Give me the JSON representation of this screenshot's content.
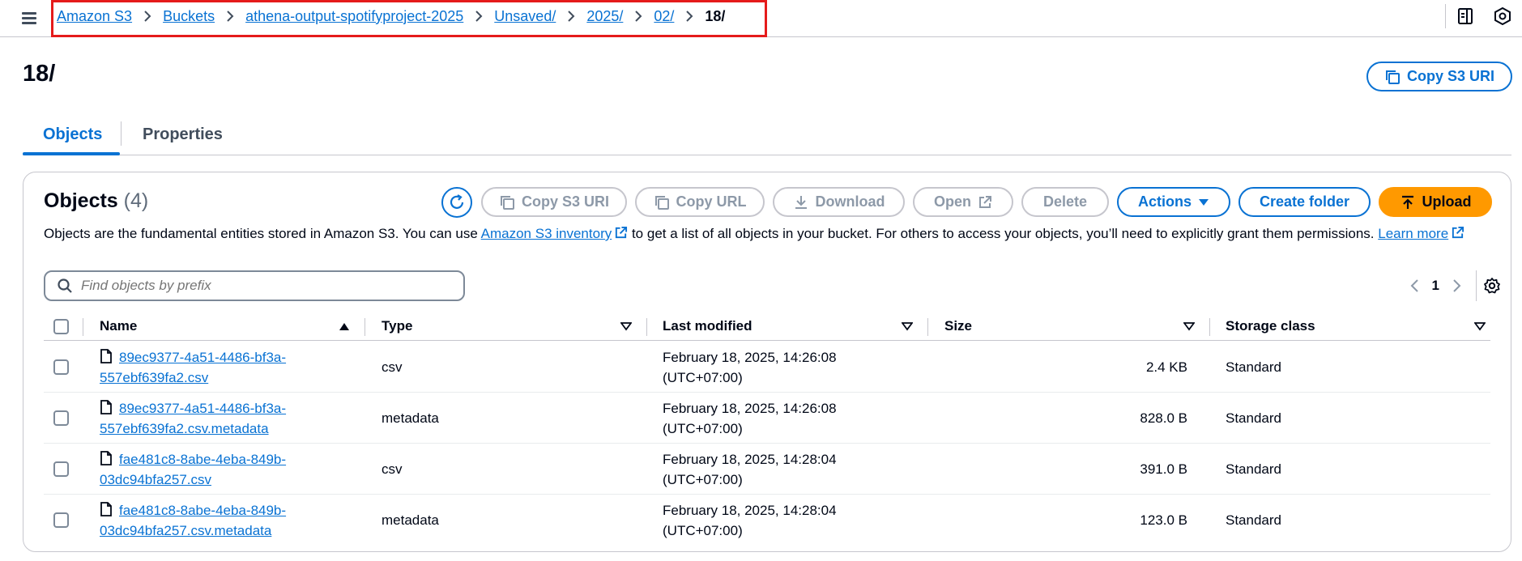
{
  "breadcrumbs": {
    "items": [
      "Amazon S3",
      "Buckets",
      "athena-output-spotifyproject-2025",
      "Unsaved/",
      "2025/",
      "02/"
    ],
    "current": "18/"
  },
  "header": {
    "title": "18/",
    "copy_s3_uri": "Copy S3 URI"
  },
  "tabs": [
    {
      "label": "Objects",
      "active": true
    },
    {
      "label": "Properties",
      "active": false
    }
  ],
  "objects_panel": {
    "title": "Objects",
    "count": "(4)",
    "buttons": {
      "copy_s3_uri": "Copy S3 URI",
      "copy_url": "Copy URL",
      "download": "Download",
      "open": "Open",
      "delete": "Delete",
      "actions": "Actions",
      "create_folder": "Create folder",
      "upload": "Upload"
    },
    "description": {
      "part1": "Objects are the fundamental entities stored in Amazon S3. You can use ",
      "link1": "Amazon S3 inventory",
      "part2": " to get a list of all objects in your bucket. For others to access your objects, you’ll need to explicitly grant them permissions. ",
      "link2": "Learn more"
    },
    "search": {
      "placeholder": "Find objects by prefix",
      "value": ""
    },
    "pagination": {
      "current_page": "1"
    }
  },
  "table": {
    "columns": [
      "Name",
      "Type",
      "Last modified",
      "Size",
      "Storage class"
    ],
    "rows": [
      {
        "name_line1": "89ec9377-4a51-4486-bf3a-",
        "name_line2": "557ebf639fa2.csv",
        "type": "csv",
        "modified_line1": "February 18, 2025, 14:26:08",
        "modified_line2": "(UTC+07:00)",
        "size": "2.4 KB",
        "storage": "Standard"
      },
      {
        "name_line1": "89ec9377-4a51-4486-bf3a-",
        "name_line2": "557ebf639fa2.csv.metadata",
        "type": "metadata",
        "modified_line1": "February 18, 2025, 14:26:08",
        "modified_line2": "(UTC+07:00)",
        "size": "828.0 B",
        "storage": "Standard"
      },
      {
        "name_line1": "fae481c8-8abe-4eba-849b-",
        "name_line2": "03dc94bfa257.csv",
        "type": "csv",
        "modified_line1": "February 18, 2025, 14:28:04",
        "modified_line2": "(UTC+07:00)",
        "size": "391.0 B",
        "storage": "Standard"
      },
      {
        "name_line1": "fae481c8-8abe-4eba-849b-",
        "name_line2": "03dc94bfa257.csv.metadata",
        "type": "metadata",
        "modified_line1": "February 18, 2025, 14:28:04",
        "modified_line2": "(UTC+07:00)",
        "size": "123.0 B",
        "storage": "Standard"
      }
    ]
  },
  "colors": {
    "link": "#0972d3",
    "upload": "#ff9900",
    "highlight_box": "#e51b1b"
  }
}
